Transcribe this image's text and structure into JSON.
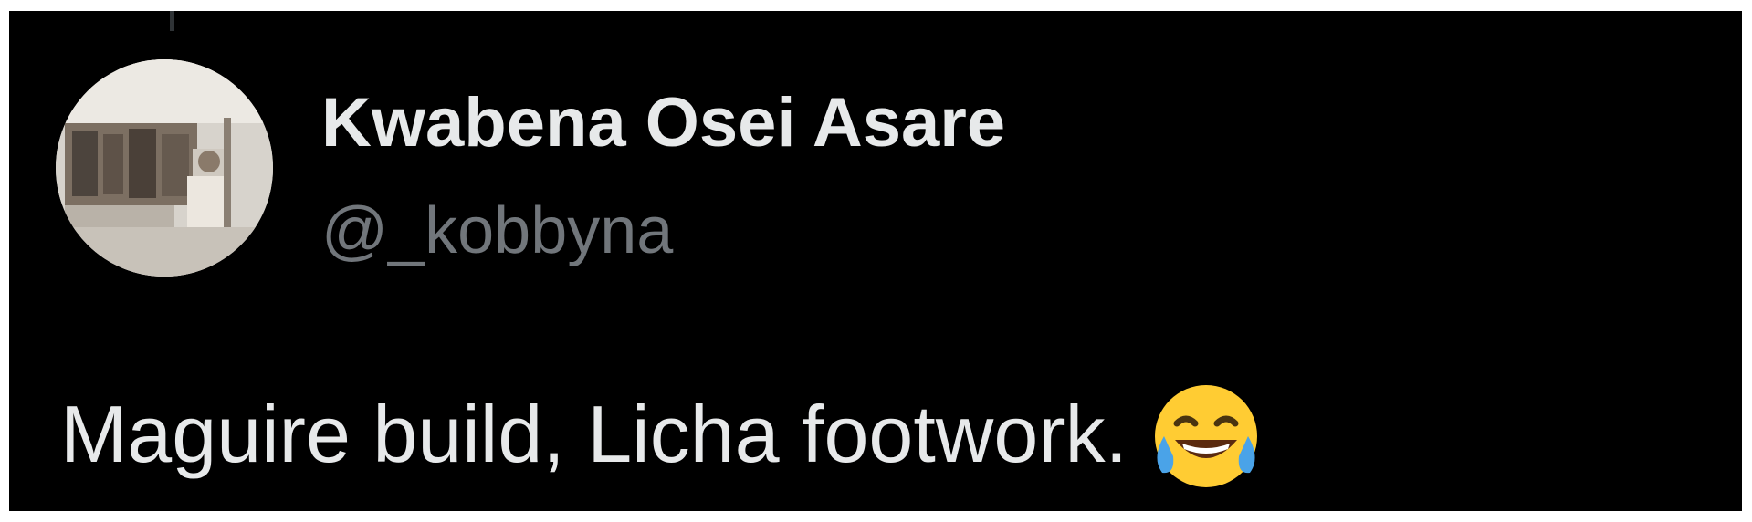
{
  "author": {
    "display_name": "Kwabena Osei Asare",
    "handle": "@_kobbyna",
    "avatar_icon": "user-avatar-photo"
  },
  "tweet": {
    "text": "Maguire build, Licha footwork.",
    "emoji_icon": "face-with-tears-of-joy-icon"
  },
  "colors": {
    "card_background": "#000000",
    "name_text": "#e7e9ea",
    "handle_text": "#71767b",
    "body_text": "#e7e9ea"
  }
}
